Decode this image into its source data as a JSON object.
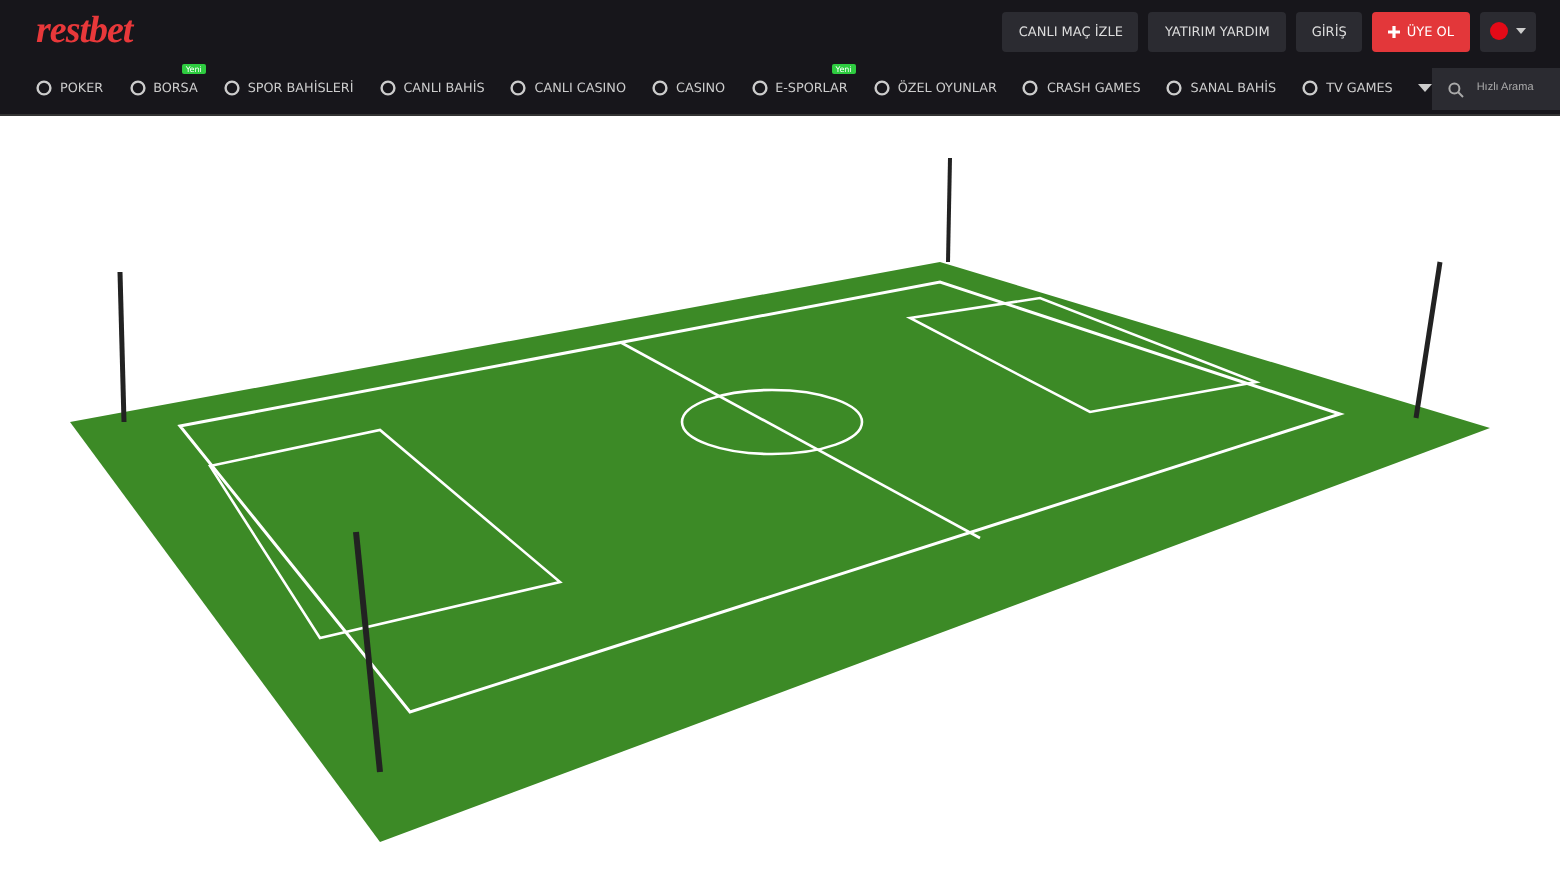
{
  "logo": "restbet",
  "top_buttons": [
    {
      "label": "CANLI MAÇ İZLE",
      "kind": "dark"
    },
    {
      "label": "YATIRIM YARDIM",
      "kind": "dark"
    },
    {
      "label": "GİRİŞ",
      "kind": "dark"
    },
    {
      "label": "ÜYE OL",
      "kind": "primary"
    }
  ],
  "nav": [
    {
      "label": "POKER"
    },
    {
      "label": "BORSA",
      "badge": "Yeni"
    },
    {
      "label": "SPOR BAHİSLERİ"
    },
    {
      "label": "CANLI BAHİS"
    },
    {
      "label": "CANLI CASINO"
    },
    {
      "label": "CASINO"
    },
    {
      "label": "E-SPORLAR",
      "badge": "Yeni"
    },
    {
      "label": "ÖZEL OYUNLAR"
    },
    {
      "label": "CRASH GAMES"
    },
    {
      "label": "SANAL BAHİS"
    },
    {
      "label": "TV GAMES"
    }
  ],
  "search": {
    "placeholder": "Hızlı Arama"
  }
}
